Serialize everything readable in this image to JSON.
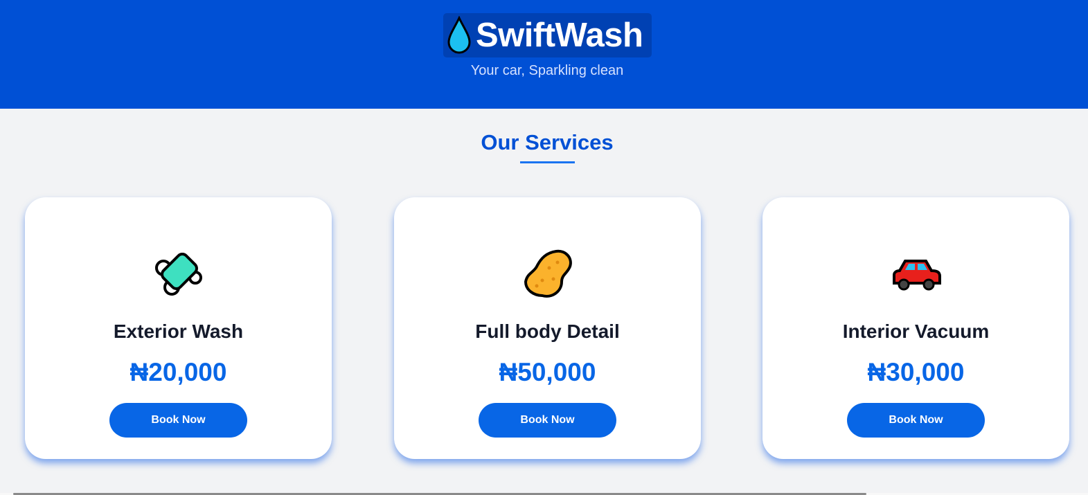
{
  "header": {
    "brand": "SwiftWash",
    "tagline": "Your car, Sparkling clean",
    "logo_icon": "water-drop-icon"
  },
  "services": {
    "title": "Our Services",
    "items": [
      {
        "icon": "soap-icon",
        "name": "Exterior Wash",
        "price": "₦20,000",
        "button": "Book Now"
      },
      {
        "icon": "sponge-icon",
        "name": "Full body Detail",
        "price": "₦50,000",
        "button": "Book Now"
      },
      {
        "icon": "car-icon",
        "name": "Interior Vacuum",
        "price": "₦30,000",
        "button": "Book Now"
      }
    ]
  },
  "colors": {
    "primary": "#0050d5",
    "accent": "#0866e6",
    "background": "#f2f3f5"
  }
}
